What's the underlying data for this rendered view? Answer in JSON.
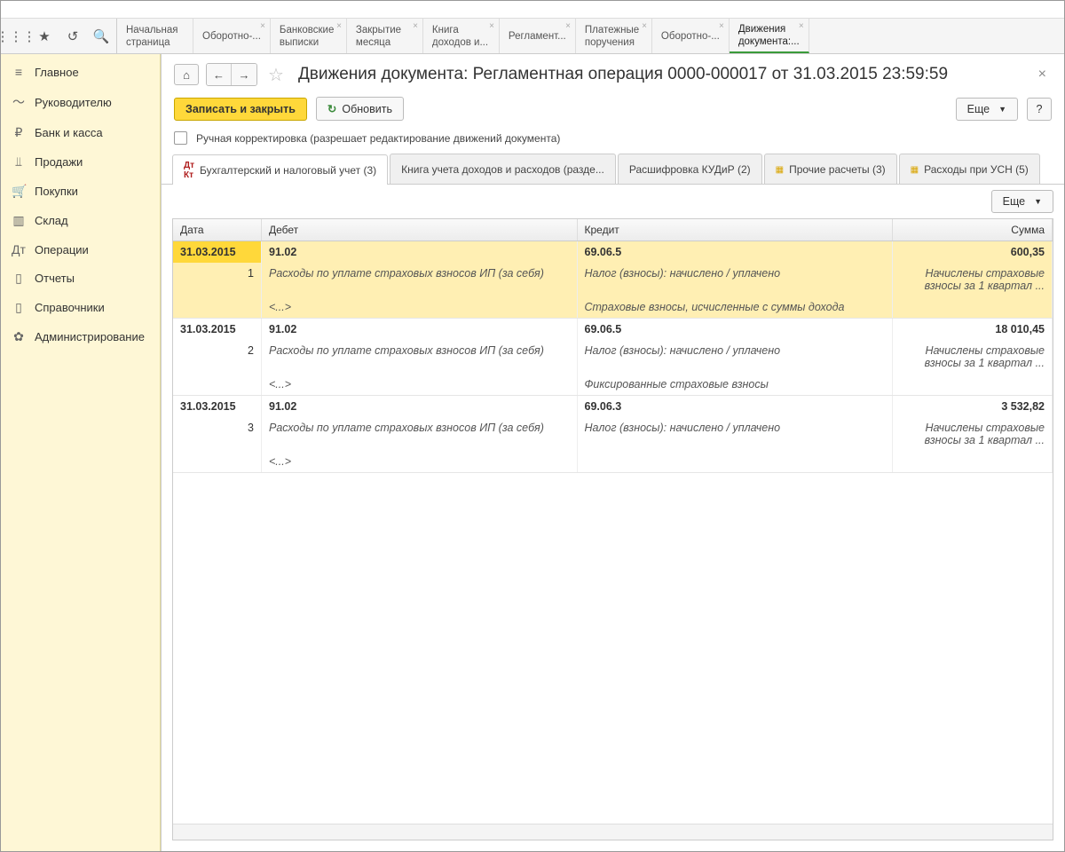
{
  "tabs": [
    {
      "l1": "Начальная",
      "l2": "страница"
    },
    {
      "l1": "Оборотно-...",
      "l2": ""
    },
    {
      "l1": "Банковские",
      "l2": "выписки"
    },
    {
      "l1": "Закрытие",
      "l2": "месяца"
    },
    {
      "l1": "Книга",
      "l2": "доходов и..."
    },
    {
      "l1": "Регламент...",
      "l2": ""
    },
    {
      "l1": "Платежные",
      "l2": "поручения"
    },
    {
      "l1": "Оборотно-...",
      "l2": ""
    },
    {
      "l1": "Движения",
      "l2": "документа:..."
    }
  ],
  "sidebar": {
    "items": [
      {
        "label": "Главное",
        "icon": "≡"
      },
      {
        "label": "Руководителю",
        "icon": "〜"
      },
      {
        "label": "Банк и касса",
        "icon": "₽"
      },
      {
        "label": "Продажи",
        "icon": "⫫"
      },
      {
        "label": "Покупки",
        "icon": "🛒"
      },
      {
        "label": "Склад",
        "icon": "▥"
      },
      {
        "label": "Операции",
        "icon": "Дт"
      },
      {
        "label": "Отчеты",
        "icon": "▯"
      },
      {
        "label": "Справочники",
        "icon": "▯"
      },
      {
        "label": "Администрирование",
        "icon": "✿"
      }
    ]
  },
  "header": {
    "title": "Движения документа: Регламентная операция 0000-000017 от 31.03.2015 23:59:59"
  },
  "toolbar": {
    "save_close": "Записать и закрыть",
    "refresh": "Обновить",
    "more": "Еще",
    "help": "?"
  },
  "manual": {
    "label": "Ручная корректировка (разрешает редактирование движений документа)"
  },
  "dtabs": [
    {
      "label": "Бухгалтерский и налоговый учет (3)",
      "icon": "dk"
    },
    {
      "label": "Книга учета доходов и расходов (разде..."
    },
    {
      "label": "Расшифровка КУДиР (2)"
    },
    {
      "label": "Прочие расчеты (3)",
      "icon": "y"
    },
    {
      "label": "Расходы при УСН (5)",
      "icon": "y"
    }
  ],
  "grid": {
    "more": "Еще",
    "headers": {
      "date": "Дата",
      "debit": "Дебет",
      "credit": "Кредит",
      "sum": "Сумма"
    },
    "rows": [
      {
        "date": "31.03.2015",
        "n": "1",
        "db": "91.02",
        "cr": "69.06.5",
        "sum": "600,35",
        "db2": "Расходы по уплате страховых взносов ИП (за себя)",
        "cr2": "Налог (взносы): начислено / уплачено",
        "db3": "<...>",
        "cr3": "Страховые взносы, исчисленные с суммы дохода",
        "note": "Начислены страховые взносы за 1 квартал ...",
        "sel": true
      },
      {
        "date": "31.03.2015",
        "n": "2",
        "db": "91.02",
        "cr": "69.06.5",
        "sum": "18 010,45",
        "db2": "Расходы по уплате страховых взносов ИП (за себя)",
        "cr2": "Налог (взносы): начислено / уплачено",
        "db3": "<...>",
        "cr3": "Фиксированные страховые взносы",
        "note": "Начислены страховые взносы за 1 квартал ..."
      },
      {
        "date": "31.03.2015",
        "n": "3",
        "db": "91.02",
        "cr": "69.06.3",
        "sum": "3 532,82",
        "db2": "Расходы по уплате страховых взносов ИП (за себя)",
        "cr2": "Налог (взносы): начислено / уплачено",
        "db3": "<...>",
        "cr3": "",
        "note": "Начислены страховые взносы за 1 квартал ..."
      }
    ]
  }
}
